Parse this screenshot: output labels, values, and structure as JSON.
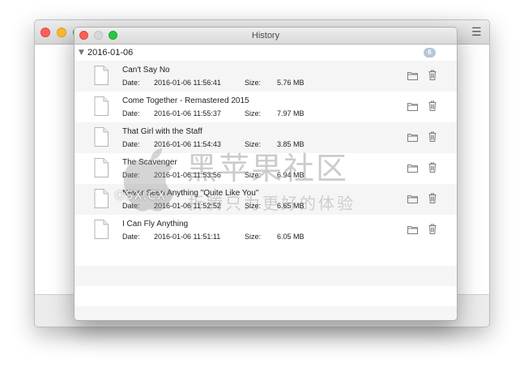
{
  "window": {
    "title": "History"
  },
  "group": {
    "date": "2016-01-06",
    "count": "6"
  },
  "labels": {
    "date": "Date:",
    "size": "Size:"
  },
  "items": [
    {
      "title": "Can't Say No",
      "date": "2016-01-06 11:56:41",
      "size": "5.76 MB"
    },
    {
      "title": "Come Together - Remastered 2015",
      "date": "2016-01-06 11:55:37",
      "size": "7.97 MB"
    },
    {
      "title": "That Girl with the Staff",
      "date": "2016-01-06 11:54:43",
      "size": "3.85 MB"
    },
    {
      "title": "The Scavenger",
      "date": "2016-01-06 11:53:56",
      "size": "6.94 MB"
    },
    {
      "title": "Never Seen Anything \"Quite Like You\"",
      "date": "2016-01-06 11:52:52",
      "size": "6.65 MB"
    },
    {
      "title": "I Can Fly Anything",
      "date": "2016-01-06 11:51:11",
      "size": "6.05 MB"
    }
  ],
  "watermark": {
    "brand": "OSX.CX",
    "main": "黑苹果社区",
    "sub": "折腾只为更好的体验"
  },
  "icons": {
    "file": "document-icon",
    "folder": "folder-icon",
    "trash": "trash-icon",
    "menu": "hamburger-menu-icon"
  },
  "colors": {
    "close": "#fc5f57",
    "minimize": "#fdbc2e",
    "zoom": "#28c840",
    "badge": "#b7c6d8",
    "row_alt": "#f5f5f5"
  }
}
